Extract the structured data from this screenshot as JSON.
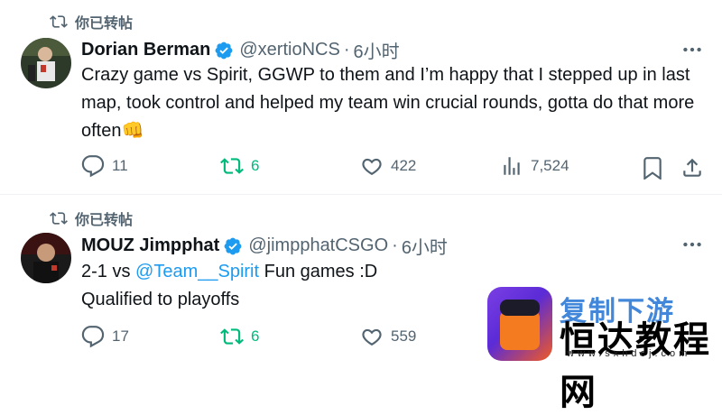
{
  "tweets": [
    {
      "retweet_label": "你已转帖",
      "name": "Dorian Berman",
      "handle": "@xertioNCS",
      "dot": "·",
      "time": "6小时",
      "body": "Crazy game vs Spirit, GGWP to them and I’m happy that I stepped up in last map, took control and helped my team win crucial rounds, gotta do that more often👊",
      "replies": "11",
      "reposts": "6",
      "likes": "422",
      "views": "7,524"
    },
    {
      "retweet_label": "你已转帖",
      "name": "MOUZ Jimpphat",
      "handle": "@jimpphatCSGO",
      "dot": "·",
      "time": "6小时",
      "body_prefix": "2-1 vs ",
      "body_mention": "@Team__Spirit",
      "body_suffix": " Fun games :D",
      "body_line2": "Qualified to playoffs",
      "replies": "17",
      "reposts": "6",
      "likes": "559"
    }
  ],
  "watermark": {
    "blue_text": "复制下游",
    "main_text": "恒达教程网",
    "url": "www.sxhdcj.com"
  },
  "colors": {
    "accent": "#1d9bf0",
    "repost": "#00ba7c",
    "muted": "#536471"
  }
}
